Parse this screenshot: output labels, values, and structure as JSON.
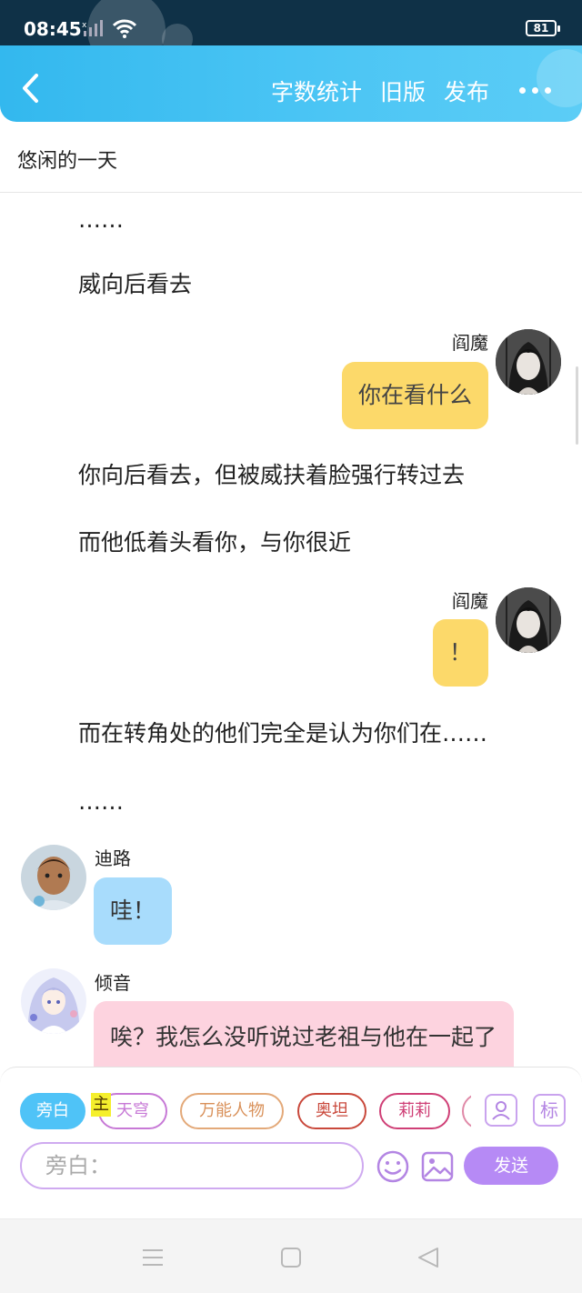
{
  "status_bar": {
    "time": "08:45",
    "battery": "81"
  },
  "header": {
    "word_count": "字数统计",
    "old_version": "旧版",
    "publish": "发布"
  },
  "story": {
    "title": "悠闲的一天",
    "narration_1": "……",
    "narration_2": "威向后看去",
    "message_1": {
      "speaker": "阎魔",
      "text": "你在看什么"
    },
    "narration_3": "你向后看去，但被威扶着脸强行转过去",
    "narration_4": "而他低着头看你，与你很近",
    "message_2": {
      "speaker": "阎魔",
      "text": "！"
    },
    "narration_5": "而在转角处的他们完全是认为你们在……",
    "narration_6": "……",
    "message_3": {
      "speaker": "迪路",
      "text": "哇！"
    },
    "message_4": {
      "speaker": "倾音",
      "text": "唉？我怎么没听说过老祖与他在一起了"
    }
  },
  "composer": {
    "characters": [
      "旁白",
      "天穹",
      "万能人物",
      "奥坦",
      "莉莉"
    ],
    "main_tag": "主",
    "mark_label": "标",
    "input_placeholder": "旁白：",
    "send_label": "发送"
  },
  "colors": {
    "header_gradient_start": "#33b8ee",
    "self_bubble": "#fcd96a",
    "blue_bubble": "#a8dcfc",
    "pink_bubble": "#fdd3df",
    "send_button": "#b68af5"
  }
}
